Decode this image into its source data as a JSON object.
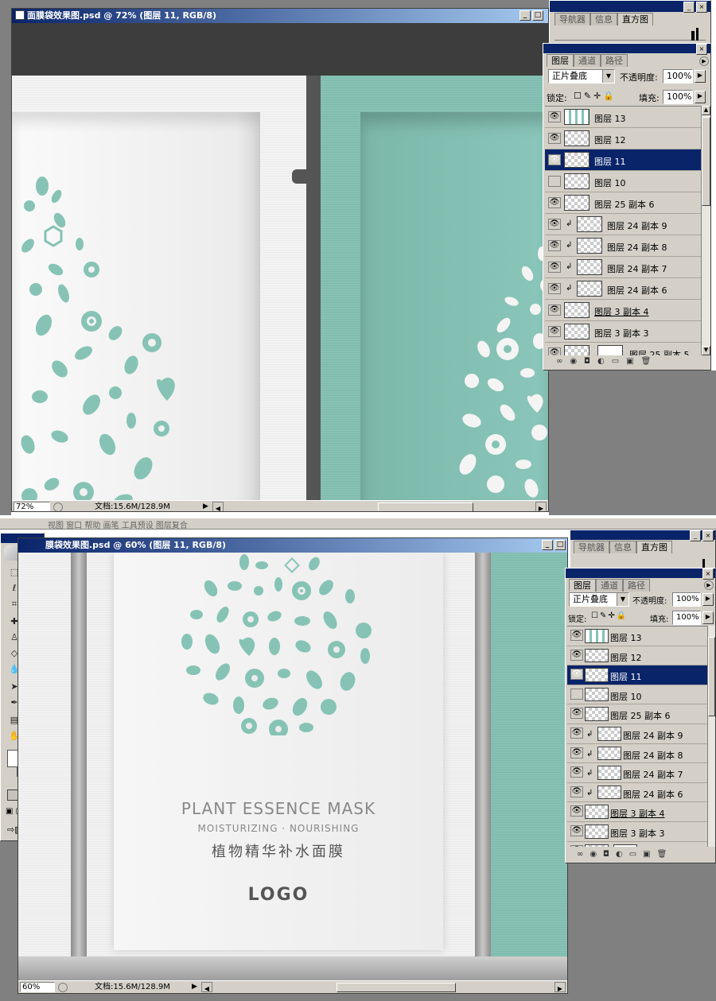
{
  "win1": {
    "title": "面膜袋效果图.psd @ 72% (图层 11, RGB/8)",
    "zoom": "72%",
    "doc": "文档:15.6M/128.9M"
  },
  "win2": {
    "title": "膜袋效果图.psd @ 60% (图层 11, RGB/8)",
    "zoom": "60%",
    "doc": "文档:15.6M/128.9M"
  },
  "winbtns": {
    "min": "_",
    "max": "□",
    "close": "×"
  },
  "top_panel": {
    "tabs": [
      "导航器",
      "信息",
      "直方图"
    ]
  },
  "layers_panel": {
    "tabs": [
      "图层",
      "通道",
      "路径"
    ],
    "blend_mode": "正片叠底",
    "opacity_label": "不透明度:",
    "opacity_value": "100%",
    "lock_label": "锁定:",
    "fill_label": "填充:",
    "fill_value": "100%",
    "layers": [
      {
        "name": "图层 13",
        "visible": true,
        "selected": false,
        "clipped": false
      },
      {
        "name": "图层 12",
        "visible": true,
        "selected": false,
        "clipped": false
      },
      {
        "name": "图层 11",
        "visible": true,
        "selected": true,
        "clipped": false
      },
      {
        "name": "图层 10",
        "visible": false,
        "selected": false,
        "clipped": false
      },
      {
        "name": "图层 25 副本 6",
        "visible": true,
        "selected": false,
        "clipped": false
      },
      {
        "name": "图层 24 副本 9",
        "visible": true,
        "selected": false,
        "clipped": true
      },
      {
        "name": "图层 24 副本 8",
        "visible": true,
        "selected": false,
        "clipped": true
      },
      {
        "name": "图层 24 副本 7",
        "visible": true,
        "selected": false,
        "clipped": true
      },
      {
        "name": "图层 24 副本 6",
        "visible": true,
        "selected": false,
        "clipped": true
      },
      {
        "name": "图层 3 副本 4",
        "visible": true,
        "selected": false,
        "clipped": false
      },
      {
        "name": "图层 3 副本 3",
        "visible": true,
        "selected": false,
        "clipped": false
      },
      {
        "name": "图层 25 副本 5",
        "visible": true,
        "selected": false,
        "clipped": false
      }
    ]
  },
  "mask_design": {
    "title": "PLANT ESSENCE MASK",
    "subtitle": "MOISTURIZING · NOURISHING",
    "chinese": "植物精华补水面膜",
    "logo": "LOGO"
  },
  "menu_strip": "视图 窗口 帮助   画笔  工具预设  图层复合",
  "colors": {
    "teal": "#88c3b6",
    "selection": "#0a246a",
    "panel": "#d4d0c8"
  }
}
